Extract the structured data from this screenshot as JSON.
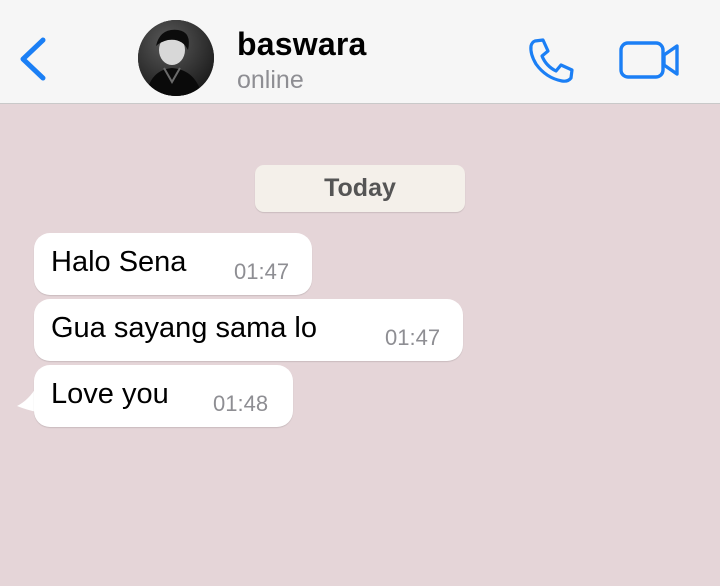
{
  "header": {
    "contact_name": "baswara",
    "contact_status": "online",
    "back_icon": "chevron-left-icon",
    "call_icon": "phone-icon",
    "video_icon": "video-camera-icon",
    "accent_color": "#1b7ff5"
  },
  "chat": {
    "date_label": "Today",
    "background_color": "#e5d5d8",
    "messages": [
      {
        "text": "Halo Sena",
        "time": "01:47"
      },
      {
        "text": "Gua sayang sama lo",
        "time": "01:47"
      },
      {
        "text": "Love you",
        "time": "01:48"
      }
    ]
  }
}
